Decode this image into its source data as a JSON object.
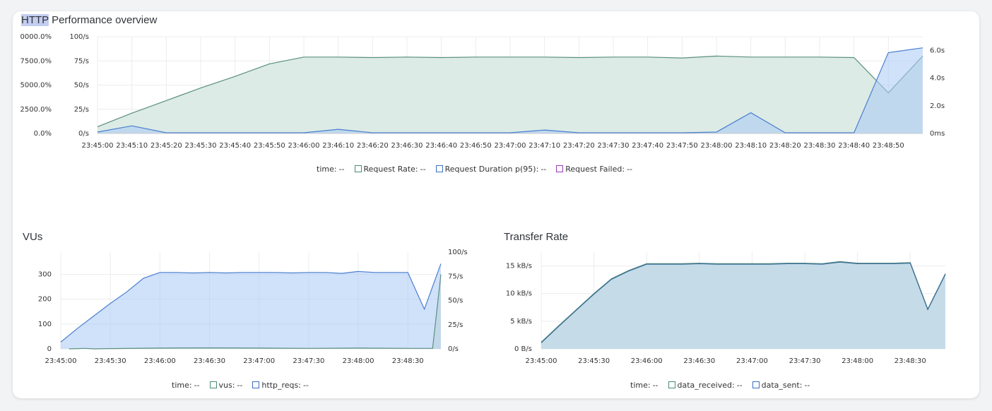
{
  "panels": {
    "http": {
      "title_hl": "HTTP",
      "title_rest": " Performance overview"
    },
    "vus": {
      "title": "VUs"
    },
    "transfer": {
      "title": "Transfer Rate"
    }
  },
  "legends": {
    "http": [
      {
        "label": "time:",
        "value": "--",
        "swatch": false
      },
      {
        "label": "Request Rate:",
        "value": "--",
        "swatch": true,
        "color": "#4a8a78"
      },
      {
        "label": "Request Duration p(95):",
        "value": "--",
        "swatch": true,
        "color": "#3a6fc4"
      },
      {
        "label": "Request Failed:",
        "value": "--",
        "swatch": true,
        "color": "#9b38b8"
      }
    ],
    "vus": [
      {
        "label": "time:",
        "value": "--",
        "swatch": false
      },
      {
        "label": "vus:",
        "value": "--",
        "swatch": true,
        "color": "#4a8a78"
      },
      {
        "label": "http_reqs:",
        "value": "--",
        "swatch": true,
        "color": "#3a6fc4"
      }
    ],
    "transfer": [
      {
        "label": "time:",
        "value": "--",
        "swatch": false
      },
      {
        "label": "data_received:",
        "value": "--",
        "swatch": true,
        "color": "#4a8a78"
      },
      {
        "label": "data_sent:",
        "value": "--",
        "swatch": true,
        "color": "#3a6fc4"
      }
    ]
  },
  "colors": {
    "green_stroke": "#5b8f80",
    "green_fill": "#dcebe5",
    "blue_stroke": "#4a7fd0",
    "blue_fill": "rgba(170,200,245,0.55)",
    "steel_fill": "#c5dbe8",
    "steel_stroke": "#3b6e98",
    "grid": "#ebecee",
    "axis_text": "#333333"
  },
  "chart_data": [
    {
      "type": "area",
      "title": "HTTP Performance overview",
      "x": [
        "23:45:00",
        "23:45:10",
        "23:45:20",
        "23:45:30",
        "23:45:40",
        "23:45:50",
        "23:46:00",
        "23:46:10",
        "23:46:20",
        "23:46:30",
        "23:46:40",
        "23:46:50",
        "23:47:00",
        "23:47:10",
        "23:47:20",
        "23:47:30",
        "23:47:40",
        "23:47:50",
        "23:48:00",
        "23:48:10",
        "23:48:20",
        "23:48:30",
        "23:48:40",
        "23:48:50",
        "23:49:00"
      ],
      "x_ticks": [
        "23:45:00",
        "23:45:10",
        "23:45:20",
        "23:45:30",
        "23:45:40",
        "23:45:50",
        "23:46:00",
        "23:46:10",
        "23:46:20",
        "23:46:30",
        "23:46:40",
        "23:46:50",
        "23:47:00",
        "23:47:10",
        "23:47:20",
        "23:47:30",
        "23:47:40",
        "23:47:50",
        "23:48:00",
        "23:48:10",
        "23:48:20",
        "23:48:30",
        "23:48:40",
        "23:48:50"
      ],
      "y_left_pct_ticks": [
        "0.0%",
        "2500.0%",
        "5000.0%",
        "7500.0%",
        "0000.0%"
      ],
      "y_left_rate_ticks": [
        "0/s",
        "25/s",
        "50/s",
        "75/s",
        "100/s"
      ],
      "y_right_ticks": [
        "0ms",
        "2.0s",
        "4.0s",
        "6.0s"
      ],
      "ylim_rate": [
        0,
        100
      ],
      "ylim_duration_s": [
        0,
        7
      ],
      "series": [
        {
          "name": "Request Rate",
          "axis": "rate",
          "values": [
            7,
            21,
            34,
            47,
            59,
            72,
            79,
            79,
            78.5,
            79,
            78.5,
            79,
            79,
            79,
            78.5,
            79,
            79,
            78,
            80,
            79,
            79,
            79,
            78.5,
            42,
            80
          ]
        },
        {
          "name": "Request Duration p(95)",
          "axis": "duration_s",
          "values": [
            0.1,
            0.55,
            0.05,
            0.05,
            0.05,
            0.05,
            0.05,
            0.3,
            0.05,
            0.05,
            0.05,
            0.05,
            0.05,
            0.25,
            0.05,
            0.05,
            0.05,
            0.05,
            0.1,
            1.5,
            0.05,
            0.05,
            0.05,
            5.85,
            6.2
          ]
        },
        {
          "name": "Request Failed",
          "axis": "pct",
          "values": [
            0,
            0,
            0,
            0,
            0,
            0,
            0,
            0,
            0,
            0,
            0,
            0,
            0,
            0,
            0,
            0,
            0,
            0,
            0,
            0,
            0,
            0,
            0,
            0,
            0
          ]
        }
      ]
    },
    {
      "type": "area",
      "title": "VUs",
      "x": [
        "23:45:00",
        "23:45:10",
        "23:45:20",
        "23:45:30",
        "23:45:40",
        "23:45:50",
        "23:46:00",
        "23:46:10",
        "23:46:20",
        "23:46:30",
        "23:46:40",
        "23:46:50",
        "23:47:00",
        "23:47:10",
        "23:47:20",
        "23:47:30",
        "23:47:40",
        "23:47:50",
        "23:48:00",
        "23:48:10",
        "23:48:20",
        "23:48:30",
        "23:48:40",
        "23:48:50"
      ],
      "x_ticks": [
        "23:45:00",
        "23:45:30",
        "23:46:00",
        "23:46:30",
        "23:47:00",
        "23:47:30",
        "23:48:00",
        "23:48:30"
      ],
      "y_left_ticks": [
        "0",
        "100",
        "200",
        "300"
      ],
      "y_right_ticks": [
        "0/s",
        "25/s",
        "50/s",
        "75/s",
        "100/s"
      ],
      "ylim_vus": [
        0,
        390
      ],
      "ylim_rate": [
        0,
        100
      ],
      "series": [
        {
          "name": "vus",
          "axis": "vus",
          "x": [
            "23:45:05",
            "23:45:15",
            "23:45:20",
            "23:45:30",
            "23:46:00",
            "23:46:30",
            "23:47:00",
            "23:47:30",
            "23:48:00",
            "23:48:30",
            "23:48:45",
            "23:48:50"
          ],
          "values": [
            0,
            2,
            0,
            1,
            3,
            4,
            3,
            2,
            3,
            2,
            2,
            300
          ]
        },
        {
          "name": "http_reqs",
          "axis": "rate",
          "values": [
            7,
            21,
            34,
            47,
            59,
            73,
            79,
            79,
            78.5,
            79,
            78.5,
            79,
            79,
            79,
            78.5,
            79,
            79,
            78,
            80,
            79,
            79,
            79,
            41,
            88
          ]
        }
      ]
    },
    {
      "type": "area",
      "title": "Transfer Rate",
      "x": [
        "23:45:00",
        "23:45:10",
        "23:45:20",
        "23:45:30",
        "23:45:40",
        "23:45:50",
        "23:46:00",
        "23:46:10",
        "23:46:20",
        "23:46:30",
        "23:46:40",
        "23:46:50",
        "23:47:00",
        "23:47:10",
        "23:47:20",
        "23:47:30",
        "23:47:40",
        "23:47:50",
        "23:48:00",
        "23:48:10",
        "23:48:20",
        "23:48:30",
        "23:48:40",
        "23:48:50"
      ],
      "x_ticks": [
        "23:45:00",
        "23:45:30",
        "23:46:00",
        "23:46:30",
        "23:47:00",
        "23:47:30",
        "23:48:00",
        "23:48:30"
      ],
      "y_ticks": [
        "0 B/s",
        "5 kB/s",
        "10 kB/s",
        "15 kB/s"
      ],
      "ylim_kBps": [
        0,
        17.5
      ],
      "series": [
        {
          "name": "data_received",
          "values": [
            1.2,
            4.2,
            7.1,
            10,
            12.7,
            14.2,
            15.4,
            15.4,
            15.4,
            15.5,
            15.4,
            15.4,
            15.4,
            15.4,
            15.5,
            15.5,
            15.4,
            15.8,
            15.5,
            15.5,
            15.5,
            15.6,
            7.2,
            13.6
          ]
        },
        {
          "name": "data_sent",
          "values": [
            1.1,
            4.1,
            7.0,
            9.9,
            12.6,
            14.1,
            15.3,
            15.3,
            15.3,
            15.4,
            15.3,
            15.3,
            15.3,
            15.3,
            15.4,
            15.4,
            15.3,
            15.7,
            15.4,
            15.4,
            15.4,
            15.5,
            7.1,
            13.5
          ]
        }
      ]
    }
  ]
}
